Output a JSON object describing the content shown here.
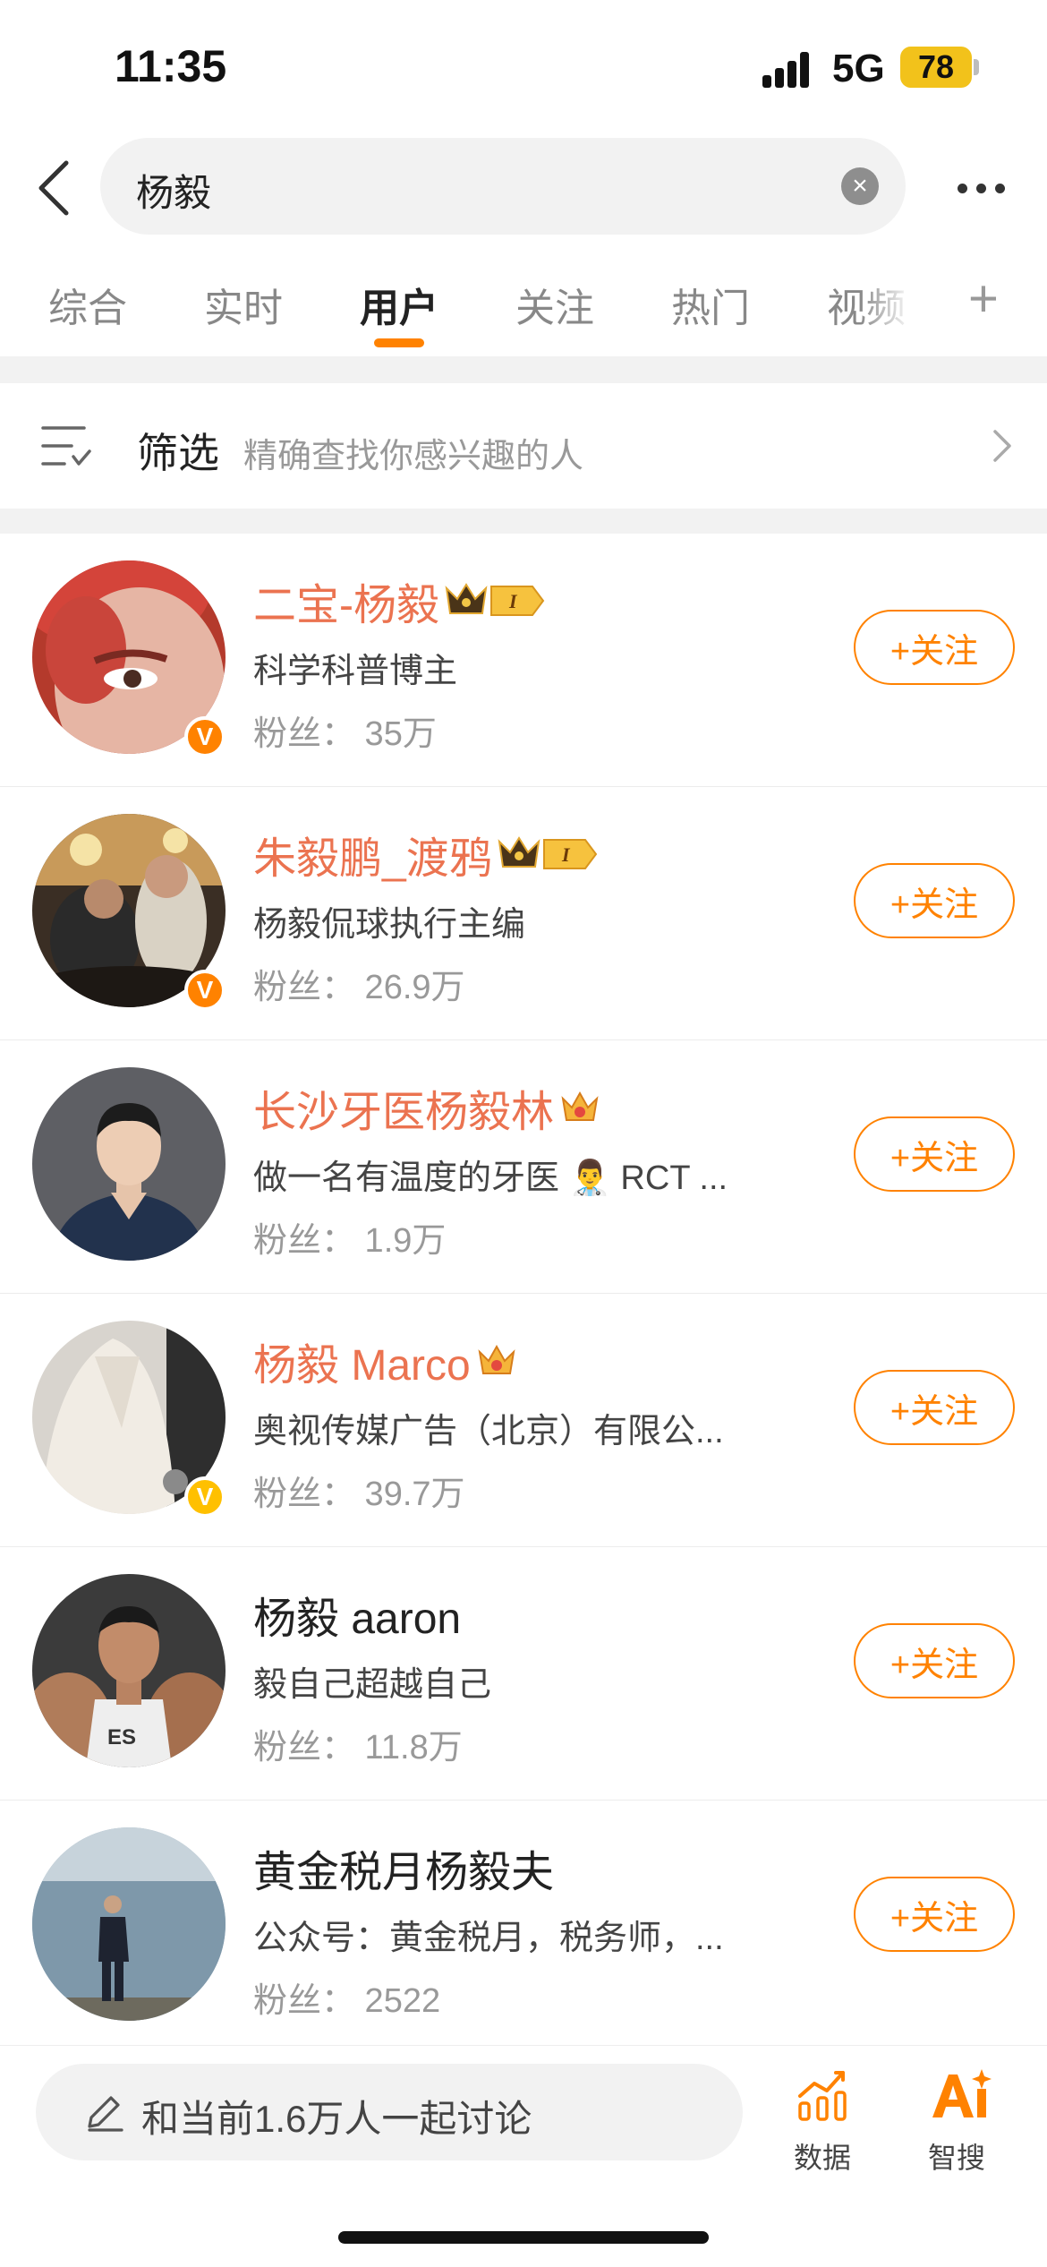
{
  "status_bar": {
    "time": "11:35",
    "network": "5G",
    "battery": "78"
  },
  "search": {
    "query": "杨毅"
  },
  "tabs": [
    {
      "label": "综合",
      "active": false
    },
    {
      "label": "实时",
      "active": false
    },
    {
      "label": "用户",
      "active": true
    },
    {
      "label": "关注",
      "active": false
    },
    {
      "label": "热门",
      "active": false
    },
    {
      "label": "视频",
      "active": false
    }
  ],
  "filter": {
    "title": "筛选",
    "subtitle": "精确查找你感兴趣的人"
  },
  "users": [
    {
      "name": "二宝-杨毅",
      "name_color": "orange",
      "crown": "crown-level-1",
      "verified": "orange",
      "description": "科学科普博主",
      "fans": "粉丝： 35万",
      "follow_label": "+关注",
      "avatar": "red-haired-portrait"
    },
    {
      "name": "朱毅鹏_渡鸦",
      "name_color": "orange",
      "crown": "crown-level-1",
      "verified": "orange",
      "description": "杨毅侃球执行主编",
      "fans": "粉丝： 26.9万",
      "follow_label": "+关注",
      "avatar": "party-crowd-photo"
    },
    {
      "name": "长沙牙医杨毅林",
      "name_color": "orange",
      "crown": "small-crown",
      "verified": "",
      "description": "做一名有温度的牙医 👨‍⚕️ RCT ...",
      "fans": "粉丝： 1.9万",
      "follow_label": "+关注",
      "avatar": "dentist-portrait"
    },
    {
      "name": "杨毅 Marco",
      "name_color": "orange",
      "crown": "small-crown",
      "verified": "gold",
      "description": "奥视传媒广告（北京）有限公...",
      "fans": "粉丝： 39.7万",
      "follow_label": "+关注",
      "avatar": "white-suit-photo"
    },
    {
      "name": "杨毅 aaron",
      "name_color": "default",
      "crown": "",
      "verified": "",
      "description": "毅自己超越自己",
      "fans": "粉丝： 11.8万",
      "follow_label": "+关注",
      "avatar": "fitness-portrait"
    },
    {
      "name": "黄金税月杨毅夫",
      "name_color": "default",
      "crown": "",
      "verified": "",
      "description": "公众号：黄金税月，税务师，...",
      "fans": "粉丝： 2522",
      "follow_label": "+关注",
      "avatar": "lakeside-photo"
    }
  ],
  "bottom": {
    "discuss_label": "和当前1.6万人一起讨论",
    "data_label": "数据",
    "ai_label": "智搜"
  },
  "colors": {
    "accent": "#ff8200",
    "name_orange": "#eb7350",
    "gold_badge": "#ffc000"
  }
}
